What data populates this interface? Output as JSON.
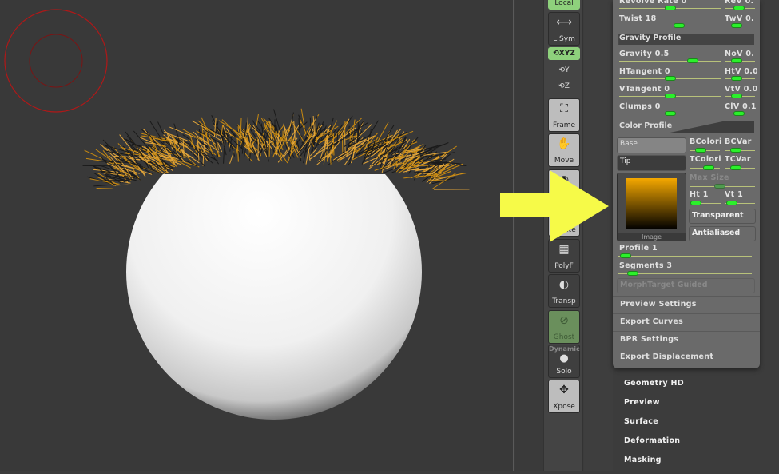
{
  "toolbar": {
    "local": "Local",
    "lsym": "L.Sym",
    "xyz": "XYZ",
    "y": "Y",
    "z": "Z",
    "frame": "Frame",
    "move": "Move",
    "rotate": "Rotate",
    "polyf": "PolyF",
    "transp": "Transp",
    "ghost": "Ghost",
    "dynamic": "Dynamic",
    "solo": "Solo",
    "xpose": "Xpose"
  },
  "panel": {
    "sliders": [
      {
        "label": "Revolve Rate 0",
        "pos": 0.5,
        "sub": "ReV 0.",
        "subpos": 0.45
      },
      {
        "label": "Twist 18",
        "pos": 0.6,
        "sub": "TwV 0.",
        "subpos": 0.35
      },
      {
        "label": "Gravity 0.5",
        "pos": 0.75,
        "sub": "NoV 0.",
        "subpos": 0.35
      },
      {
        "label": "HTangent 0",
        "pos": 0.5,
        "sub": "HtV 0.0",
        "subpos": 0.35
      },
      {
        "label": "VTangent 0",
        "pos": 0.5,
        "sub": "VtV 0.0",
        "subpos": 0.35
      },
      {
        "label": "Clumps 0",
        "pos": 0.5,
        "sub": "ClV 0.1",
        "subpos": 0.45
      }
    ],
    "gravity_profile": "Gravity Profile",
    "color_profile": "Color Profile",
    "base": "Base",
    "tip": "Tip",
    "image": "Image",
    "bcolori": "BColori",
    "bcvar": "BCVar",
    "tcolori": "TColori",
    "tcvar": "TCVar",
    "max_size": "Max Size",
    "ht": "Ht 1",
    "vt": "Vt 1",
    "transparent": "Transparent",
    "antialiased": "Antialiased",
    "profile": "Profile 1",
    "profile_pos": 0.02,
    "segments": "Segments 3",
    "segments_pos": 0.08,
    "morph": "MorphTarget Guided",
    "sections": [
      "Preview Settings",
      "Export Curves",
      "BPR Settings",
      "Export Displacement"
    ],
    "colors": {
      "tip": "#f5a800",
      "base": "#000000"
    }
  },
  "menu": [
    "Geometry HD",
    "Preview",
    "Surface",
    "Deformation",
    "Masking"
  ]
}
